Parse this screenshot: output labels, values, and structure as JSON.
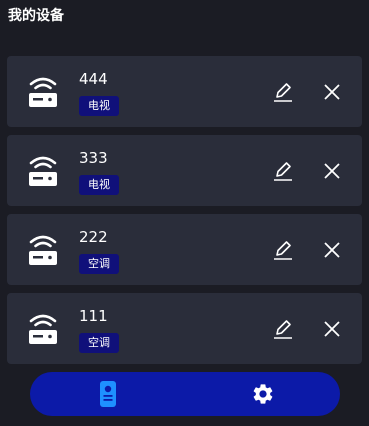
{
  "page": {
    "title": "我的设备"
  },
  "devices": [
    {
      "name": "444",
      "type": "电视"
    },
    {
      "name": "333",
      "type": "电视"
    },
    {
      "name": "222",
      "type": "空调"
    },
    {
      "name": "111",
      "type": "空调"
    }
  ],
  "icons": {
    "device": "router-icon",
    "edit": "pencil-icon",
    "delete": "close-icon",
    "nav_devices": "device-remote-icon",
    "nav_settings": "gear-icon"
  },
  "colors": {
    "background": "#1b1c24",
    "card": "#2a2d3a",
    "badge": "#10107a",
    "nav_bar": "#0c1aa8",
    "nav_active_icon": "#1e90ff",
    "text": "#ffffff"
  }
}
